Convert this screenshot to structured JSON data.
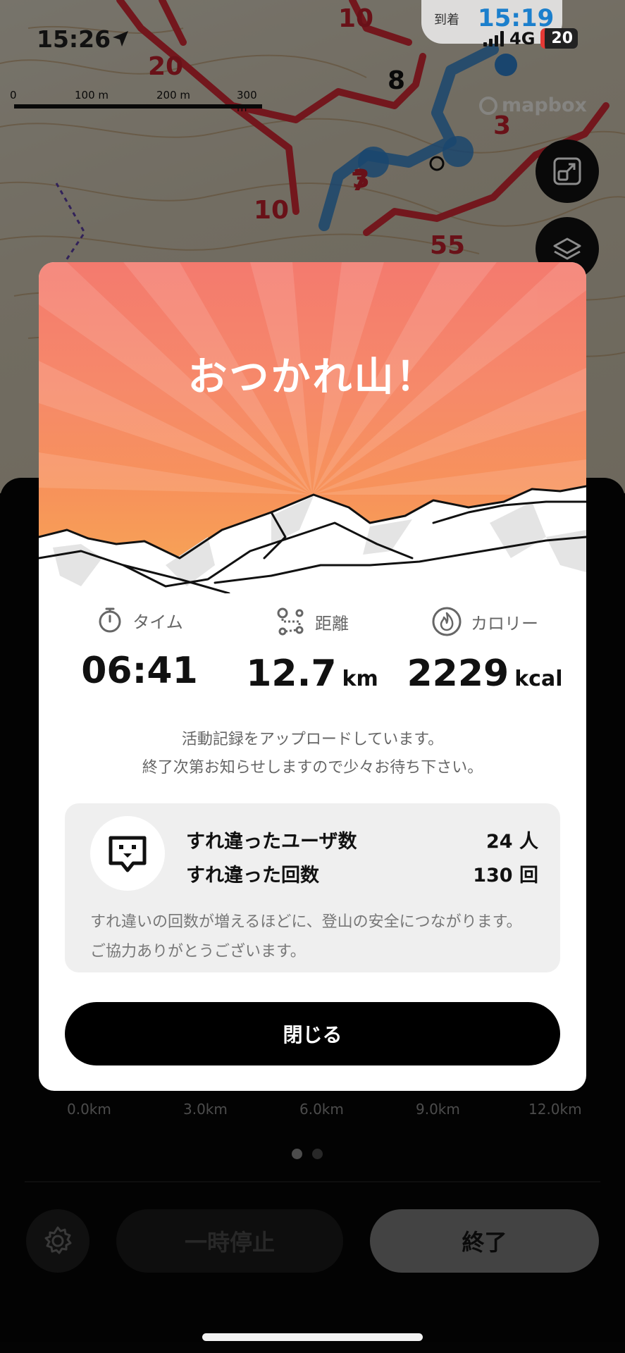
{
  "status_bar": {
    "time": "15:26",
    "network": "4G",
    "battery": "20"
  },
  "arrival": {
    "label": "到着",
    "time": "15:19"
  },
  "map": {
    "scale_labels": [
      "0",
      "100 m",
      "200 m",
      "300 m"
    ],
    "attribution": "mapbox",
    "number_labels": [
      "10",
      "20",
      "10",
      "55",
      "7",
      "3",
      "3",
      "8"
    ]
  },
  "modal": {
    "title": "おつかれ山！",
    "stats": [
      {
        "label": "タイム",
        "value": "06:41",
        "unit": "",
        "icon": "stopwatch-icon"
      },
      {
        "label": "距離",
        "value": "12.7",
        "unit": "km",
        "icon": "route-icon"
      },
      {
        "label": "カロリー",
        "value": "2229",
        "unit": "kcal",
        "icon": "flame-icon"
      }
    ],
    "upload_line1": "活動記録をアップロードしています。",
    "upload_line2": "終了次第お知らせしますので少々お待ち下さい。",
    "passing": {
      "users_label": "すれ違ったユーザ数",
      "users_value": "24 人",
      "count_label": "すれ違った回数",
      "count_value": "130 回",
      "note": "すれ違いの回数が増えるほどに、登山の安全につながります。ご協力ありがとうございます。"
    },
    "close_label": "閉じる"
  },
  "bottom": {
    "km_axis": [
      "0.0km",
      "3.0km",
      "6.0km",
      "9.0km",
      "12.0km"
    ],
    "pause_label": "一時停止",
    "end_label": "終了"
  },
  "colors": {
    "accent_orange": "#f7935a",
    "title_coral": "#f47a6e",
    "route_red": "#d12a35",
    "route_blue": "#2f7fc8"
  }
}
